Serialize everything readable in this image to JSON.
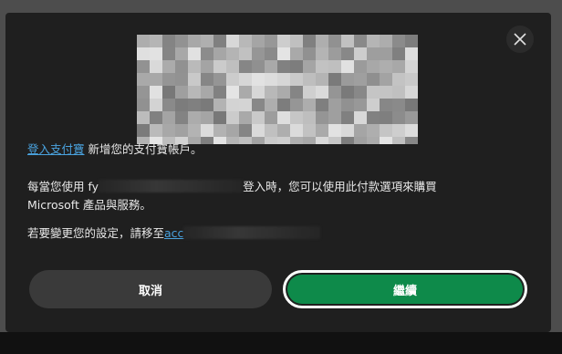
{
  "dialog": {
    "close_icon": "close-icon",
    "logo": "redacted-logo-image",
    "line1": {
      "link": "登入支付寶",
      "rest": " 新增您的支付寶帳戶。"
    },
    "line2": {
      "prefix": "每當您使用 fy",
      "suffix": "登入時，您可以使用此付款選項來購買"
    },
    "line3": "Microsoft 產品與服務。",
    "line4": {
      "prefix": "若要變更您的設定，請移至",
      "link": "acc"
    },
    "buttons": {
      "cancel": "取消",
      "continue": "繼續"
    }
  },
  "colors": {
    "dialog_bg": "#1f1f1f",
    "link": "#4aa3df",
    "primary": "#0e8a4a",
    "secondary": "#3a3a3a"
  }
}
